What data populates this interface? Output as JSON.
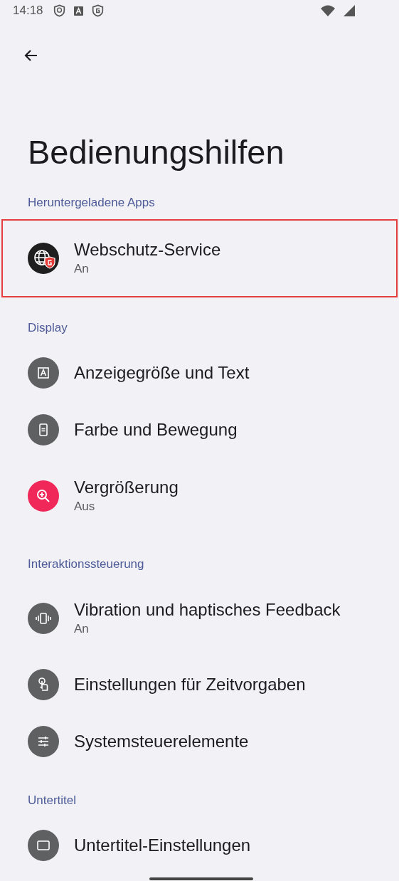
{
  "status_bar": {
    "time": "14:18"
  },
  "title": "Bedienungshilfen",
  "sections": [
    {
      "header": "Heruntergeladene Apps",
      "items": [
        {
          "title": "Webschutz-Service",
          "subtitle": "An",
          "highlighted": true,
          "color": "#1f1f1f"
        }
      ]
    },
    {
      "header": "Display",
      "items": [
        {
          "title": "Anzeigegröße und Text",
          "highlighted": false,
          "color": "#5f6062"
        },
        {
          "title": "Farbe und Bewegung",
          "highlighted": false,
          "color": "#5f6062"
        },
        {
          "title": "Vergrößerung",
          "subtitle": "Aus",
          "highlighted": false,
          "color": "#f0285a"
        }
      ]
    },
    {
      "header": "Interaktionssteuerung",
      "items": [
        {
          "title": "Vibration und haptisches Feedback",
          "subtitle": "An",
          "highlighted": false,
          "color": "#5f6062"
        },
        {
          "title": "Einstellungen für Zeitvorgaben",
          "highlighted": false,
          "color": "#5f6062"
        },
        {
          "title": "Systemsteuerelemente",
          "highlighted": false,
          "color": "#5f6062"
        }
      ]
    },
    {
      "header": "Untertitel",
      "items": [
        {
          "title": "Untertitel-Einstellungen",
          "highlighted": false,
          "color": "#5f6062"
        }
      ]
    }
  ]
}
